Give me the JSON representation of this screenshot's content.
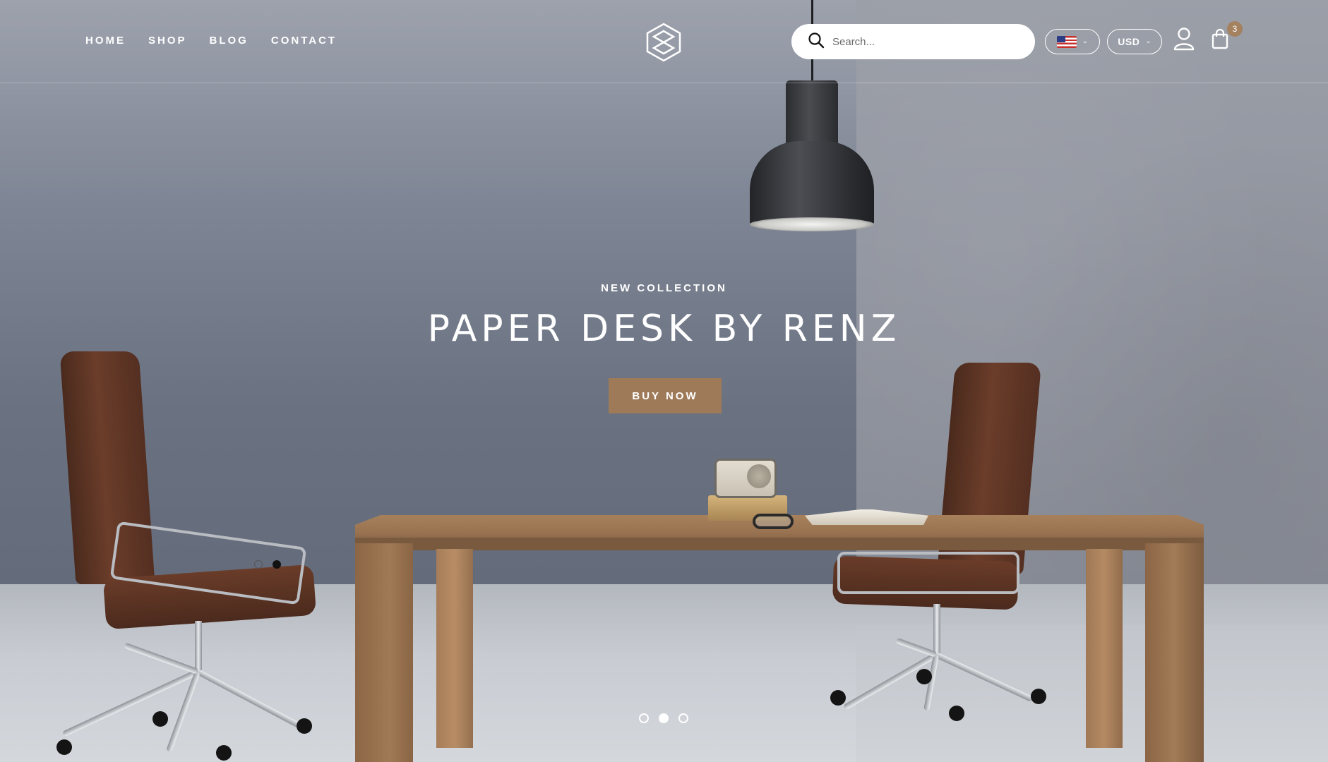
{
  "nav": {
    "items": [
      "HOME",
      "SHOP",
      "BLOG",
      "CONTACT"
    ]
  },
  "logo": {
    "icon": "diamond-logo-icon"
  },
  "search": {
    "placeholder": "Search..."
  },
  "language": {
    "selected": "en-US",
    "icon": "us-flag-icon"
  },
  "currency": {
    "selected": "USD"
  },
  "account": {
    "icon": "user-icon"
  },
  "cart": {
    "icon": "shopping-bag-icon",
    "count": "3"
  },
  "hero": {
    "subtitle": "NEW COLLECTION",
    "title": "PAPER DESK BY RENZ",
    "cta": "BUY NOW"
  },
  "slider": {
    "total": 3,
    "active": 2
  },
  "colors": {
    "accent": "#9e7a58",
    "badge": "#a4815f",
    "text": "#ffffff"
  }
}
